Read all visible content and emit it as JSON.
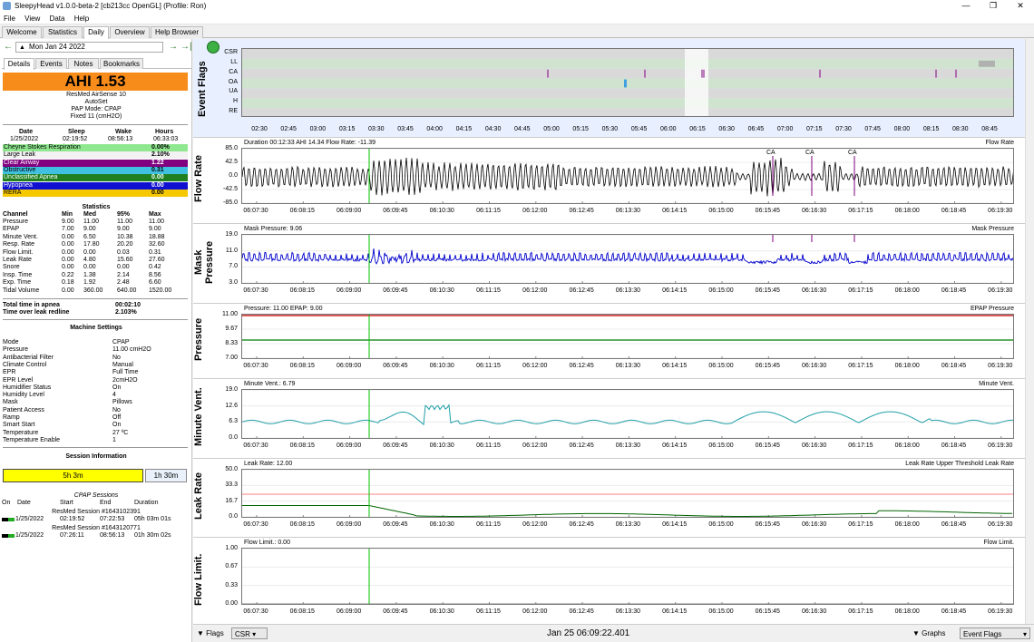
{
  "window": {
    "title": "SleepyHead v1.0.0-beta-2 [cb213cc OpenGL] (Profile: Ron)",
    "minimize": "—",
    "maximize": "❐",
    "close": "✕"
  },
  "menu": [
    "File",
    "View",
    "Data",
    "Help"
  ],
  "tabs": [
    "Welcome",
    "Statistics",
    "Daily",
    "Overview",
    "Help Browser"
  ],
  "active_tab": "Daily",
  "date_nav": {
    "prev": "←",
    "date": "Mon Jan 24 2022",
    "next": "→",
    "jump": "→|"
  },
  "left_tabs": [
    "Details",
    "Events",
    "Notes",
    "Bookmarks"
  ],
  "ahi": {
    "text": "AHI 1.53",
    "color": "#f88c1a"
  },
  "machine": [
    "ResMed AirSense 10",
    "AutoSet",
    "PAP Mode: CPAP",
    "Fixed 11 (cmH2O)"
  ],
  "sleep_header": {
    "date": "Date",
    "sleep": "Sleep",
    "wake": "Wake",
    "hours": "Hours"
  },
  "sleep_values": {
    "date": "1/25/2022",
    "sleep": "02:19:52",
    "wake": "08:56:13",
    "hours": "06:33:03"
  },
  "indices": [
    {
      "name": "Cheyne Stokes Respiration",
      "value": "0.00%",
      "color": "#8fe88f",
      "text": "#000"
    },
    {
      "name": "Large Leak",
      "value": "2.10%",
      "color": "#f2f2f2",
      "text": "#000"
    },
    {
      "name": "Clear Airway",
      "value": "1.22",
      "color": "#800080",
      "text": "#fff"
    },
    {
      "name": "Obstructive",
      "value": "0.31",
      "color": "#40c0e0",
      "text": "#000"
    },
    {
      "name": "Unclassified Apnea",
      "value": "0.00",
      "color": "#208020",
      "text": "#fff"
    },
    {
      "name": "Hypopnea",
      "value": "0.00",
      "color": "#1010d0",
      "text": "#fff"
    },
    {
      "name": "RERA",
      "value": "0.00",
      "color": "#f5c800",
      "text": "#000"
    }
  ],
  "statistics": {
    "title": "Statistics",
    "headers": [
      "Channel",
      "Min",
      "Med",
      "95%",
      "Max"
    ],
    "rows": [
      [
        "Pressure",
        "9.00",
        "11.00",
        "11.00",
        "11.00"
      ],
      [
        "EPAP",
        "7.00",
        "9.00",
        "9.00",
        "9.00"
      ],
      [
        "Minute Vent.",
        "0.00",
        "6.50",
        "10.38",
        "18.88"
      ],
      [
        "Resp. Rate",
        "0.00",
        "17.80",
        "20.20",
        "32.60"
      ],
      [
        "Flow Limit.",
        "0.00",
        "0.00",
        "0.03",
        "0.31"
      ],
      [
        "Leak Rate",
        "0.00",
        "4.80",
        "15.60",
        "27.60"
      ],
      [
        "Snore",
        "0.00",
        "0.00",
        "0.00",
        "0.42"
      ],
      [
        "Insp. Time",
        "0.22",
        "1.38",
        "2.14",
        "8.56"
      ],
      [
        "Exp. Time",
        "0.18",
        "1.92",
        "2.48",
        "6.60"
      ],
      [
        "Tidal Volume",
        "0.00",
        "360.00",
        "640.00",
        "1520.00"
      ]
    ]
  },
  "totals": [
    {
      "label": "Total time in apnea",
      "value": "00:02:10"
    },
    {
      "label": "Time over leak redline",
      "value": "2.103%"
    }
  ],
  "machine_settings": {
    "title": "Machine Settings",
    "rows": [
      [
        "Mode",
        "CPAP"
      ],
      [
        "Pressure",
        "11.00 cmH2O"
      ],
      [
        "Antibacterial Filter",
        "No"
      ],
      [
        "Climate Control",
        "Manual"
      ],
      [
        "EPR",
        "Full Time"
      ],
      [
        "EPR Level",
        "2cmH2O"
      ],
      [
        "Humidifier Status",
        "On"
      ],
      [
        "Humidity Level",
        "4"
      ],
      [
        "Mask",
        "Pillows"
      ],
      [
        "Patient Access",
        "No"
      ],
      [
        "Ramp",
        "Off"
      ],
      [
        "Smart Start",
        "On"
      ],
      [
        "Temperature",
        "27 ºC"
      ],
      [
        "Temperature Enable",
        "1"
      ]
    ]
  },
  "session_info": {
    "title": "Session Information",
    "bar1": "5h 3m",
    "bar2": "1h 30m",
    "cpap_title": "CPAP Sessions",
    "headers": [
      "On",
      "Date",
      "Start",
      "End",
      "Duration"
    ],
    "sessions": [
      {
        "name": "ResMed Session #1643102391",
        "date": "1/25/2022",
        "start": "02:19:52",
        "end": "07:22:53",
        "duration": "05h 03m 01s"
      },
      {
        "name": "ResMed Session #1643120771",
        "date": "1/25/2022",
        "start": "07:26:11",
        "end": "08:56:13",
        "duration": "01h 30m 02s"
      }
    ]
  },
  "event_flags": {
    "label": "Event Flags",
    "rows": [
      "CSR",
      "LL",
      "CA",
      "OA",
      "UA",
      "H",
      "RE"
    ],
    "time_ticks": [
      "02:30",
      "02:45",
      "03:00",
      "03:15",
      "03:30",
      "03:45",
      "04:00",
      "04:15",
      "04:30",
      "04:45",
      "05:00",
      "05:15",
      "05:30",
      "05:45",
      "06:00",
      "06:15",
      "06:30",
      "06:45",
      "07:00",
      "07:15",
      "07:30",
      "07:45",
      "08:00",
      "08:15",
      "08:30",
      "08:45"
    ]
  },
  "x_ticks": [
    "06:07:30",
    "06:08:15",
    "06:09:00",
    "06:09:45",
    "06:10:30",
    "06:11:15",
    "06:12:00",
    "06:12:45",
    "06:13:30",
    "06:14:15",
    "06:15:00",
    "06:15:45",
    "06:16:30",
    "06:17:15",
    "06:18:00",
    "06:18:45",
    "06:19:30"
  ],
  "charts": [
    {
      "label": "Flow Rate",
      "title": "Duration 00:12:33 AHI 14.34 Flow Rate: -11.39",
      "legend": "Flow Rate",
      "yticks": [
        "85.0",
        "42.5",
        "0.0",
        "-42.5",
        "-85.0"
      ],
      "flags": [
        "CA",
        "CA",
        "CA"
      ]
    },
    {
      "label": "Mask Pressure",
      "title": "Mask Pressure: 9.06",
      "legend": "Mask Pressure",
      "yticks": [
        "19.0",
        "11.0",
        "7.0",
        "3.0"
      ]
    },
    {
      "label": "Pressure",
      "title": "Pressure: 11.00 EPAP: 9.00",
      "legend": "EPAP Pressure",
      "yticks": [
        "11.00",
        "9.67",
        "8.33",
        "7.00"
      ]
    },
    {
      "label": "Minute Vent.",
      "title": "Minute Vent.: 6.79",
      "legend": "Minute Vent.",
      "yticks": [
        "19.0",
        "12.6",
        "6.3",
        "0.0"
      ]
    },
    {
      "label": "Leak Rate",
      "title": "Leak Rate: 12.00",
      "legend": "Leak Rate Upper Threshold Leak Rate",
      "yticks": [
        "50.0",
        "33.3",
        "16.7",
        "0.0"
      ]
    },
    {
      "label": "Flow Limit.",
      "title": "Flow Limit.: 0.00",
      "legend": "Flow Limit.",
      "yticks": [
        "1.00",
        "0.67",
        "0.33",
        "0.00"
      ]
    }
  ],
  "bottom": {
    "flags_btn": "Flags",
    "csr_btn": "CSR",
    "timestamp": "Jan 25 06:09:22.401",
    "graphs_btn": "Graphs",
    "event_flags_btn": "Event Flags"
  },
  "colors": {
    "flow": "#000000",
    "mask_pressure": "#0000cc",
    "pressure": "#cc0000",
    "epap": "#008000",
    "minute_vent": "#1f9fa8",
    "leak": "#006400",
    "leak_threshold": "#ff8080",
    "cursor": "#00c000",
    "ahi_bg": "#f88c1a"
  }
}
